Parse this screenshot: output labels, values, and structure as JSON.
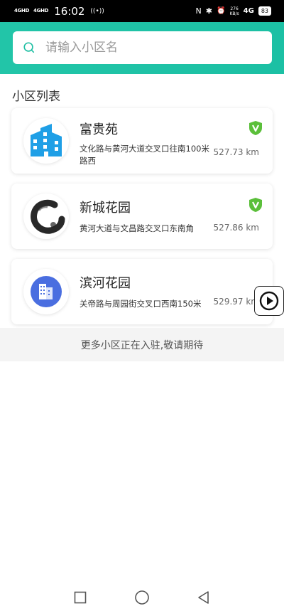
{
  "status_bar": {
    "signal_1": "4GHD",
    "signal_2": "4GHD",
    "time": "16:02",
    "hotspot": "((•))",
    "nfc": "N",
    "bluetooth": "✱",
    "alarm": "⏰",
    "speed_value": "276",
    "speed_unit": "KB/s",
    "network": "4G",
    "battery": "83"
  },
  "search": {
    "placeholder": "请输入小区名",
    "icon": "search-icon"
  },
  "section_title": "小区列表",
  "communities": [
    {
      "name": "富贵苑",
      "address": "文化路与黄河大道交叉口往南100米路西",
      "distance": "527.73 km",
      "verified": true,
      "logo": "building-logo"
    },
    {
      "name": "新城花园",
      "address": "黄河大道与文昌路交叉口东南角",
      "distance": "527.86 km",
      "verified": true,
      "logo": "ink-circle-logo"
    },
    {
      "name": "滨河花园",
      "address": "关帝路与周园街交叉口西南150米",
      "distance": "529.97 km",
      "verified": false,
      "logo": "office-building-logo"
    }
  ],
  "more_note": "更多小区正在入驻,敬请期待",
  "colors": {
    "header": "#1fc3a6",
    "verified": "#5bbf3a",
    "building_blue": "#1f9fe6",
    "office_blue": "#4a6ee0"
  },
  "nav": {
    "recent": "square-icon",
    "home": "circle-icon",
    "back": "triangle-back-icon"
  }
}
